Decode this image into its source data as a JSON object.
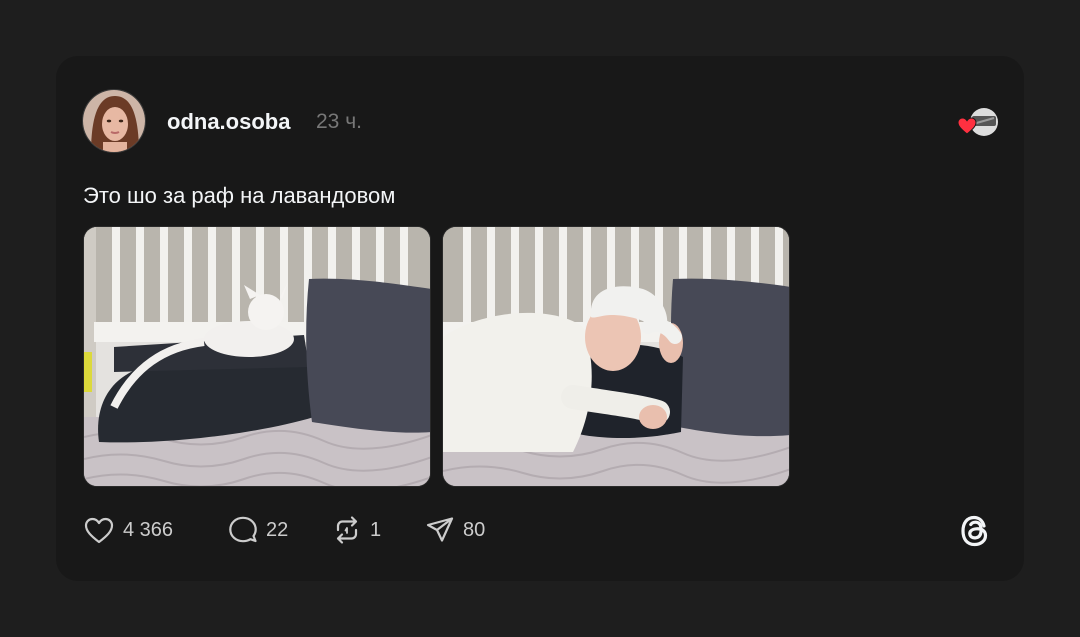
{
  "post": {
    "author": "odna.osoba",
    "time": "23 ч.",
    "text": "Это шо за раф на лавандовом"
  },
  "images": [
    {
      "description": "cat-on-pillows-photo"
    },
    {
      "description": "man-lying-on-pillows-photo"
    }
  ],
  "actions": {
    "likes": "4 366",
    "comments": "22",
    "reposts": "1",
    "shares": "80"
  },
  "icons": {
    "like": "heart-icon",
    "comment": "comment-bubble-icon",
    "repost": "repost-icon",
    "share": "send-icon",
    "logo": "threads-logo-icon",
    "reaction": "red-heart-icon"
  },
  "colors": {
    "background": "#1e1e1e",
    "card": "#181818",
    "text": "#f3f5f7",
    "muted": "#777777",
    "heart": "#ff3040"
  }
}
